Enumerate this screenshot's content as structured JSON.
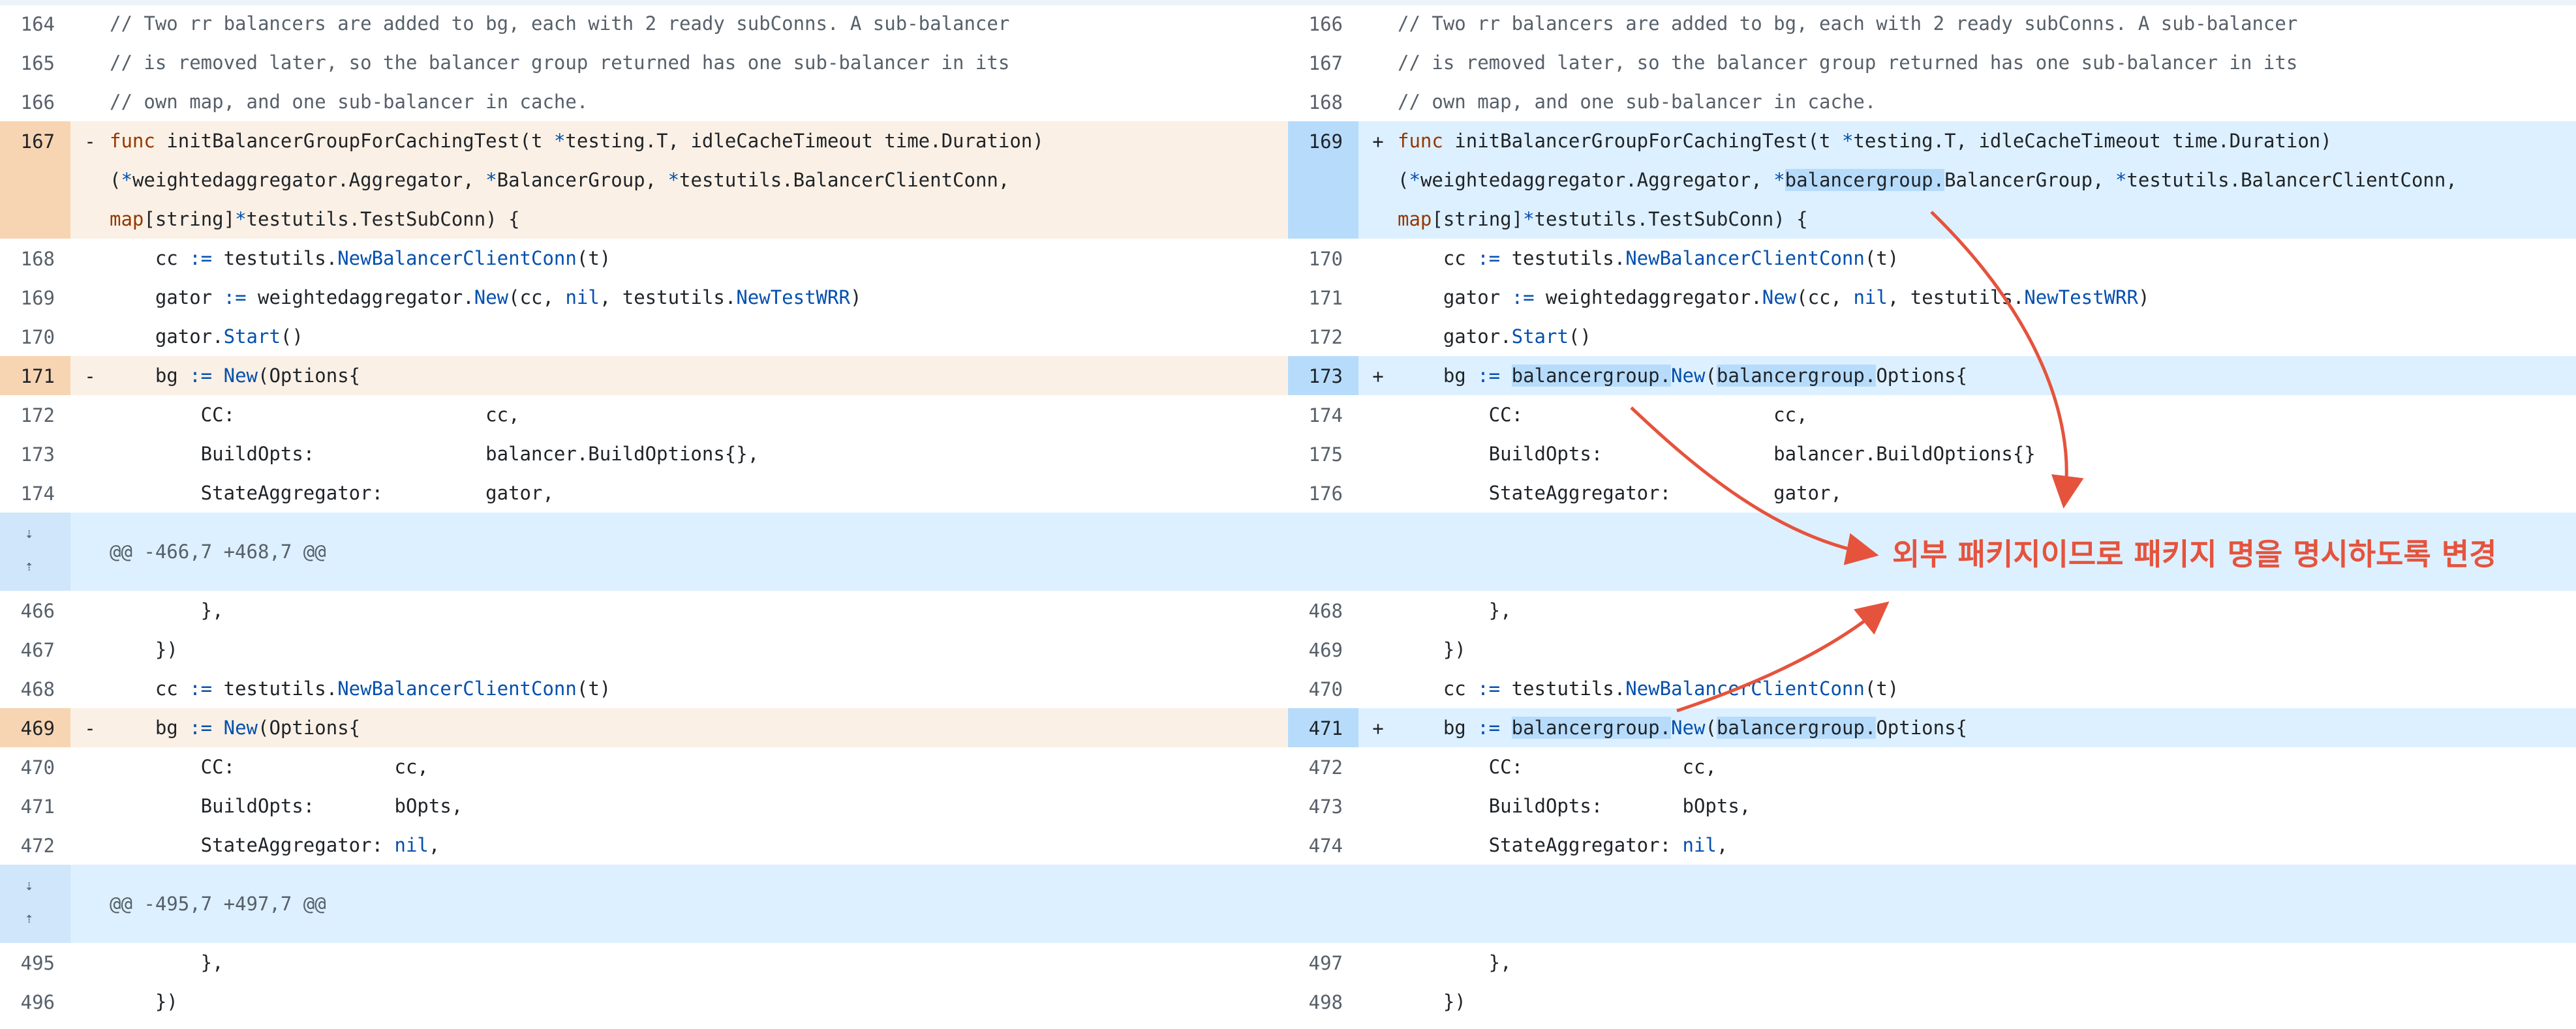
{
  "left": {
    "rows": [
      {
        "ln": "164",
        "type": "ctx",
        "code": "// Two rr balancers are added to bg, each with 2 ready subConns. A sub-balancer"
      },
      {
        "ln": "165",
        "type": "ctx",
        "code": "// is removed later, so the balancer group returned has one sub-balancer in its"
      },
      {
        "ln": "166",
        "type": "ctx",
        "code": "// own map, and one sub-balancer in cache."
      },
      {
        "ln": "167",
        "type": "del",
        "marker": "-",
        "code1": "func initBalancerGroupForCachingTest(t *testing.T, idleCacheTimeout time.Duration)",
        "code2": "(*weightedaggregator.Aggregator, *BalancerGroup, *testutils.BalancerClientConn,",
        "code3": "map[string]*testutils.TestSubConn) {"
      },
      {
        "ln": "168",
        "type": "ctx",
        "code": "    cc := testutils.NewBalancerClientConn(t)"
      },
      {
        "ln": "169",
        "type": "ctx",
        "code": "    gator := weightedaggregator.New(cc, nil, testutils.NewTestWRR)"
      },
      {
        "ln": "170",
        "type": "ctx",
        "code": "    gator.Start()"
      },
      {
        "ln": "171",
        "type": "del",
        "marker": "-",
        "code": "    bg := New(Options{"
      },
      {
        "ln": "172",
        "type": "ctx",
        "code": "        CC:                      cc,"
      },
      {
        "ln": "173",
        "type": "ctx",
        "code": "        BuildOpts:               balancer.BuildOptions{},"
      },
      {
        "ln": "174",
        "type": "ctx",
        "code": "        StateAggregator:         gator,"
      },
      {
        "type": "hunk",
        "code": "@@ -466,7 +468,7 @@"
      },
      {
        "ln": "466",
        "type": "ctx",
        "code": "        },"
      },
      {
        "ln": "467",
        "type": "ctx",
        "code": "    })"
      },
      {
        "ln": "468",
        "type": "ctx",
        "code": "    cc := testutils.NewBalancerClientConn(t)"
      },
      {
        "ln": "469",
        "type": "del",
        "marker": "-",
        "code": "    bg := New(Options{"
      },
      {
        "ln": "470",
        "type": "ctx",
        "code": "        CC:              cc,"
      },
      {
        "ln": "471",
        "type": "ctx",
        "code": "        BuildOpts:       bOpts,"
      },
      {
        "ln": "472",
        "type": "ctx",
        "code": "        StateAggregator: nil,"
      },
      {
        "type": "hunk",
        "code": "@@ -495,7 +497,7 @@"
      },
      {
        "ln": "495",
        "type": "ctx",
        "code": "        },"
      },
      {
        "ln": "496",
        "type": "ctx",
        "code": "    })"
      }
    ]
  },
  "right": {
    "rows": [
      {
        "ln": "166",
        "type": "ctx",
        "code": "// Two rr balancers are added to bg, each with 2 ready subConns. A sub-balancer"
      },
      {
        "ln": "167",
        "type": "ctx",
        "code": "// is removed later, so the balancer group returned has one sub-balancer in its"
      },
      {
        "ln": "168",
        "type": "ctx",
        "code": "// own map, and one sub-balancer in cache."
      },
      {
        "ln": "169",
        "type": "add",
        "marker": "+",
        "code1": "func initBalancerGroupForCachingTest(t *testing.T, idleCacheTimeout time.Duration)",
        "code2": "(*weightedaggregator.Aggregator, *balancergroup.BalancerGroup, *testutils.BalancerClientConn,",
        "code3": "map[string]*testutils.TestSubConn) {"
      },
      {
        "ln": "170",
        "type": "ctx",
        "code": "    cc := testutils.NewBalancerClientConn(t)"
      },
      {
        "ln": "171",
        "type": "ctx",
        "code": "    gator := weightedaggregator.New(cc, nil, testutils.NewTestWRR)"
      },
      {
        "ln": "172",
        "type": "ctx",
        "code": "    gator.Start()"
      },
      {
        "ln": "173",
        "type": "add",
        "marker": "+",
        "code": "    bg := balancergroup.New(balancergroup.Options{"
      },
      {
        "ln": "174",
        "type": "ctx",
        "code": "        CC:                      cc,"
      },
      {
        "ln": "175",
        "type": "ctx",
        "code": "        BuildOpts:               balancer.BuildOptions{}"
      },
      {
        "ln": "176",
        "type": "ctx",
        "code": "        StateAggregator:         gator,"
      },
      {
        "type": "hunk",
        "code": ""
      },
      {
        "ln": "468",
        "type": "ctx",
        "code": "        },"
      },
      {
        "ln": "469",
        "type": "ctx",
        "code": "    })"
      },
      {
        "ln": "470",
        "type": "ctx",
        "code": "    cc := testutils.NewBalancerClientConn(t)"
      },
      {
        "ln": "471",
        "type": "add",
        "marker": "+",
        "code": "    bg := balancergroup.New(balancergroup.Options{"
      },
      {
        "ln": "472",
        "type": "ctx",
        "code": "        CC:              cc,"
      },
      {
        "ln": "473",
        "type": "ctx",
        "code": "        BuildOpts:       bOpts,"
      },
      {
        "ln": "474",
        "type": "ctx",
        "code": "        StateAggregator: nil,"
      },
      {
        "type": "hunk",
        "code": ""
      },
      {
        "ln": "497",
        "type": "ctx",
        "code": "        },"
      },
      {
        "ln": "498",
        "type": "ctx",
        "code": "    })"
      }
    ]
  },
  "annotation": {
    "text": "외부 패키지이므로 패키지 명을 명시하도록 변경",
    "color": "#e5533d"
  },
  "icons": {
    "expand_down": "arrow-down-dotted-icon",
    "expand_up": "arrow-up-dotted-icon"
  },
  "colors": {
    "deleted_bg": "#fbf0e5",
    "deleted_gutter": "#f7d5b3",
    "added_bg": "#ddf0ff",
    "added_gutter": "#b7dcfb",
    "hunk_bg": "#ddf0ff"
  }
}
